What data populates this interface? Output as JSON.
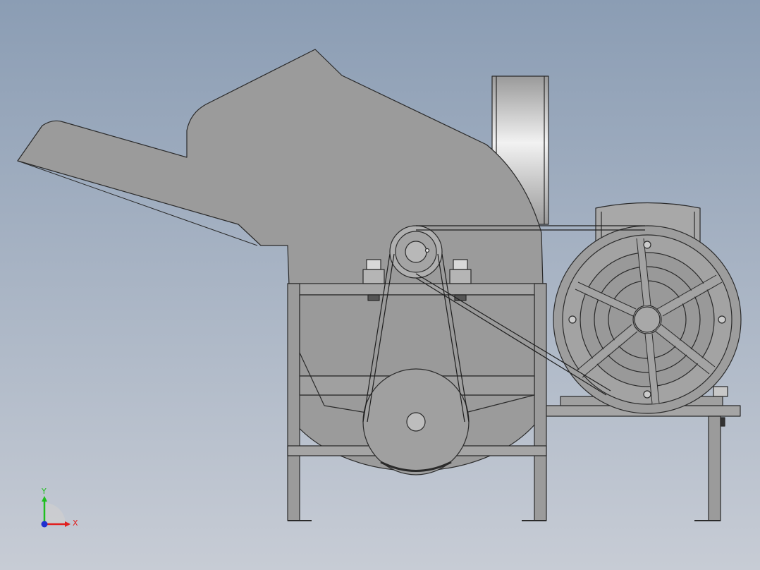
{
  "viewport": {
    "background_top": "#8b9db4",
    "background_bottom": "#c7ccd5",
    "part_fill": "#9b9b9b",
    "part_edge": "#2a2a2a",
    "belt_edge": "#1e1e1e",
    "fan_highlight": "#f2f2f2"
  },
  "model": {
    "components": [
      "feed-hopper",
      "crusher-housing",
      "discharge-fan",
      "main-frame",
      "crusher-pulley",
      "driven-pulley",
      "v-belts",
      "electric-motor",
      "motor-flywheel",
      "motor-base"
    ]
  },
  "triad": {
    "x_label": "X",
    "y_label": "Y",
    "x_color": "#e02020",
    "y_color": "#1fbf1f",
    "z_color": "#2030d0"
  }
}
